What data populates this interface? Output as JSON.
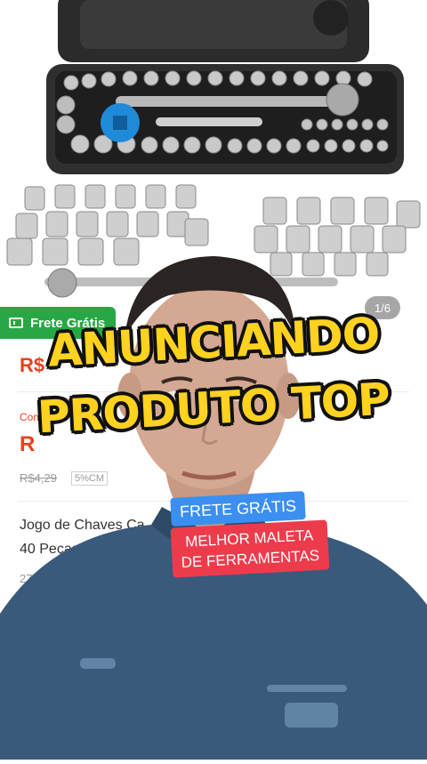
{
  "listing": {
    "free_shipping_badge": "Frete Grátis",
    "image_counter": "1/6",
    "price_main": "R$",
    "commission_label": "Comissão",
    "price_secondary": "R",
    "price_old": "R$4,29",
    "discount_badge": "5%CM",
    "title_line_1": "Jogo de Chaves Ca",
    "title_line_2": "40 Peças em Male",
    "sold_count": "27 Vendid"
  },
  "overlay": {
    "caption_line_1": "ANUNCIANDO",
    "caption_line_2": "PRODUTO TOP",
    "sticker_blue": "FRETE GRÁTIS",
    "sticker_red_line_1": "MELHOR MALETA",
    "sticker_red_line_2": "DE FERRAMENTAS"
  },
  "colors": {
    "shipping_green": "#27a844",
    "price_orange": "#e8411c",
    "caption_yellow": "#ffd21f",
    "sticker_blue": "#3b8ff0",
    "sticker_red": "#ee3b4c"
  }
}
